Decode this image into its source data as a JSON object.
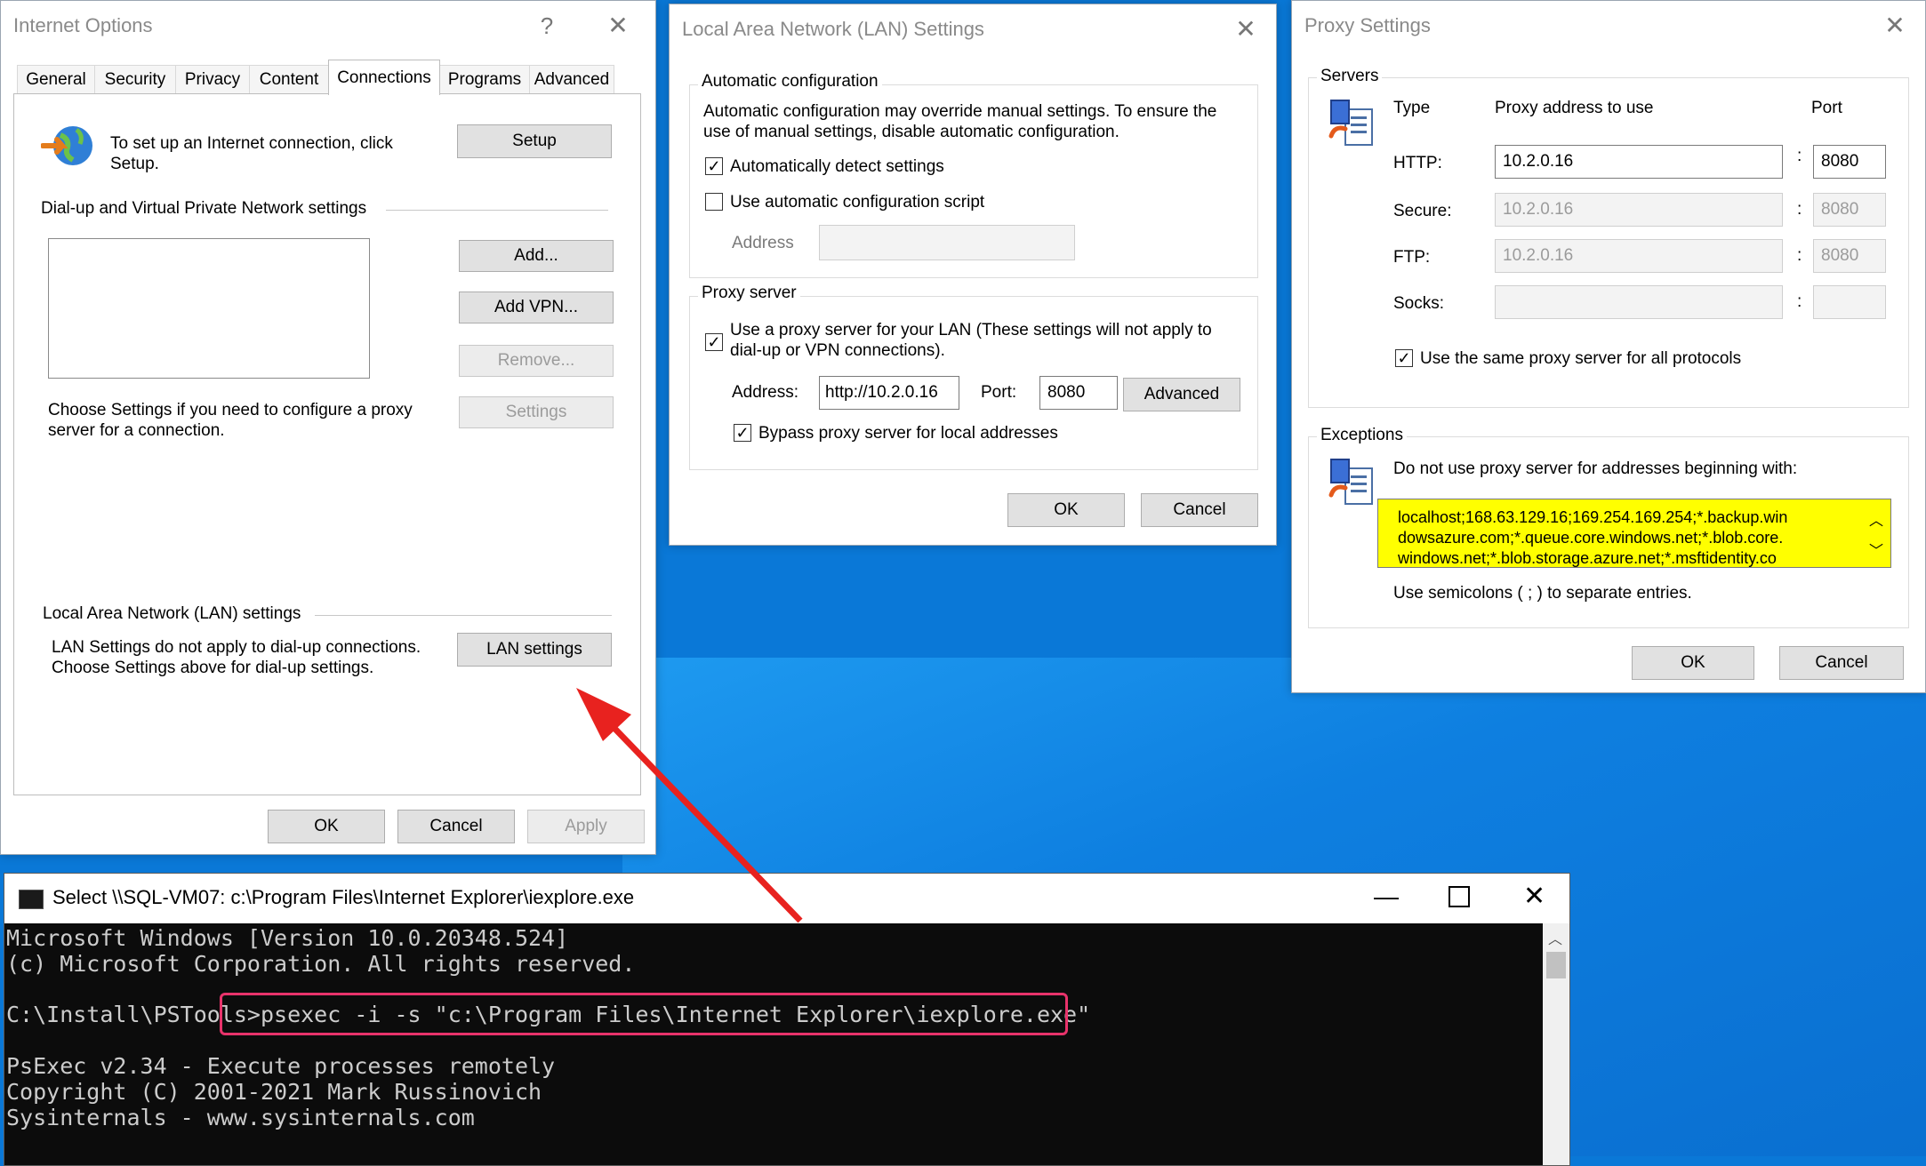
{
  "internet_options": {
    "title": "Internet Options",
    "help_symbol": "?",
    "tabs": [
      "General",
      "Security",
      "Privacy",
      "Content",
      "Connections",
      "Programs",
      "Advanced"
    ],
    "setup_text": "To set up an Internet connection, click Setup.",
    "setup_button": "Setup",
    "dialup_header": "Dial-up and Virtual Private Network settings",
    "add_button": "Add...",
    "add_vpn_button": "Add VPN...",
    "remove_button": "Remove...",
    "settings_button": "Settings",
    "proxy_hint": "Choose Settings if you need to configure a proxy server for a connection.",
    "lan_header": "Local Area Network (LAN) settings",
    "lan_text_1": "LAN Settings do not apply to dial-up connections.",
    "lan_text_2": "Choose Settings above for dial-up settings.",
    "lan_settings_button": "LAN settings",
    "ok": "OK",
    "cancel": "Cancel",
    "apply": "Apply"
  },
  "lan_dialog": {
    "title": "Local Area Network (LAN) Settings",
    "auto_config_label": "Automatic configuration",
    "auto_config_desc_1": "Automatic configuration may override manual settings.  To ensure the",
    "auto_config_desc_2": "use of manual settings, disable automatic configuration.",
    "auto_detect_label": "Automatically detect settings",
    "auto_detect_checked": true,
    "use_script_label": "Use automatic configuration script",
    "use_script_checked": false,
    "address_label": "Address",
    "proxy_server_label": "Proxy server",
    "use_proxy_label_1": "Use a proxy server for your LAN (These settings will not apply to",
    "use_proxy_label_2": "dial-up or VPN connections).",
    "use_proxy_checked": true,
    "proxy_address_label": "Address:",
    "proxy_address_value": "http://10.2.0.16",
    "port_label": "Port:",
    "port_value": "8080",
    "advanced_button": "Advanced",
    "bypass_label": "Bypass proxy server for local addresses",
    "bypass_checked": true,
    "ok": "OK",
    "cancel": "Cancel"
  },
  "proxy_dialog": {
    "title": "Proxy Settings",
    "servers_label": "Servers",
    "col_type": "Type",
    "col_address": "Proxy address to use",
    "col_port": "Port",
    "rows": [
      {
        "type": "HTTP:",
        "address": "10.2.0.16",
        "port": "8080"
      },
      {
        "type": "Secure:",
        "address": "10.2.0.16",
        "port": "8080"
      },
      {
        "type": "FTP:",
        "address": "10.2.0.16",
        "port": "8080"
      },
      {
        "type": "Socks:",
        "address": "",
        "port": ""
      }
    ],
    "colon": ":",
    "same_proxy_label": "Use the same proxy server for all protocols",
    "same_proxy_checked": true,
    "exceptions_label": "Exceptions",
    "exceptions_desc": "Do not use proxy server for addresses beginning with:",
    "exceptions_line_1": "localhost;168.63.129.16;169.254.169.254;*.backup.win",
    "exceptions_line_2": "dowsazure.com;*.queue.core.windows.net;*.blob.core.",
    "exceptions_line_3": "windows.net;*.blob.storage.azure.net;*.msftidentity.co",
    "highlight_color": "#ffff00",
    "semicolon_hint": "Use semicolons ( ; ) to separate entries.",
    "ok": "OK",
    "cancel": "Cancel"
  },
  "console": {
    "title": "Select \\\\SQL-VM07: c:\\Program Files\\Internet Explorer\\iexplore.exe",
    "lines": [
      "Microsoft Windows [Version 10.0.20348.524]",
      "(c) Microsoft Corporation. All rights reserved.",
      "",
      "C:\\Install\\PSTools>psexec -i -s \"c:\\Program Files\\Internet Explorer\\iexplore.exe\"",
      "",
      "PsExec v2.34 - Execute processes remotely",
      "Copyright (C) 2001-2021 Mark Russinovich",
      "Sysinternals - www.sysinternals.com"
    ],
    "highlight_color": "#e8336b"
  },
  "annotation": {
    "arrow_color": "#e8221f"
  }
}
